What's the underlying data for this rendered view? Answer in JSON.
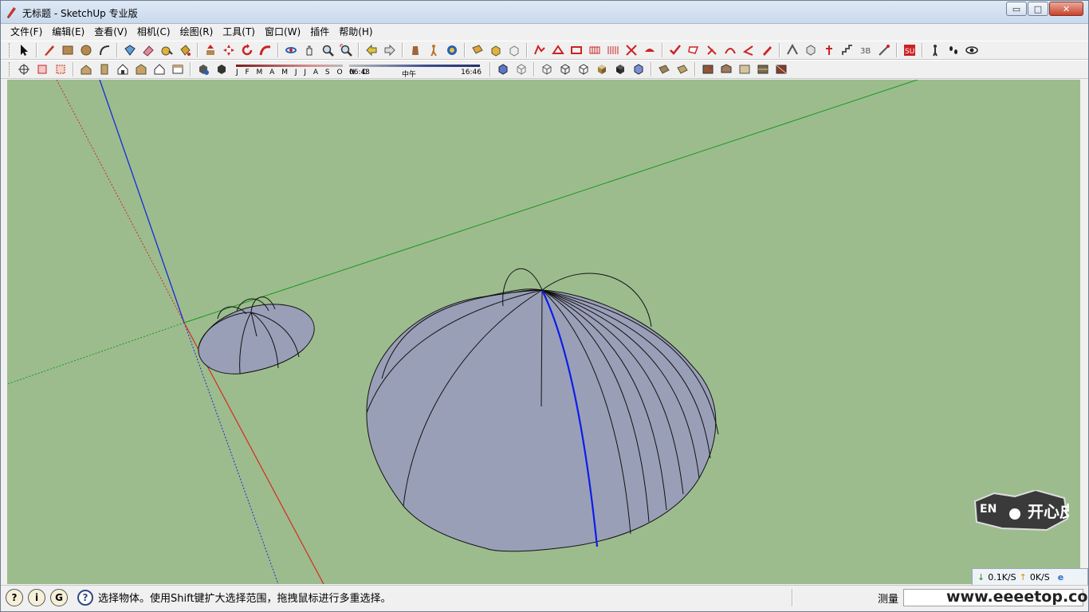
{
  "window": {
    "title": "无标题 - SketchUp 专业版",
    "controls": {
      "minimize": "▭",
      "maximize": "□",
      "close": "✕"
    }
  },
  "menu": [
    "文件(F)",
    "编辑(E)",
    "查看(V)",
    "相机(C)",
    "绘图(R)",
    "工具(T)",
    "窗口(W)",
    "插件",
    "帮助(H)"
  ],
  "shadow": {
    "months": "J F M A M J J A S O N D",
    "time_start": "06:43",
    "time_mid": "中午",
    "time_end": "16:46"
  },
  "status": {
    "message": "选择物体。使用Shift键扩大选择范围，拖拽鼠标进行多重选择。",
    "measure_label": "测量",
    "measure_value": ""
  },
  "network": {
    "down": "0.1K/S",
    "up": "0K/S"
  },
  "badge": {
    "text_en": "EN",
    "text_cn": "开心皮"
  },
  "watermark": "www.eeeetop.com",
  "colors": {
    "viewport_bg": "#9cbc8e",
    "face_fill": "#9a9fb8",
    "axis_red": "#d42b1e",
    "axis_green": "#1a9a1a",
    "axis_blue": "#1a2ad6",
    "selected_edge": "#0a1ee8"
  },
  "icons": {
    "toolbar1": [
      "select-icon",
      "pencil-icon",
      "rectangle-icon",
      "circle-icon",
      "arc-icon",
      "make-component-icon",
      "eraser-icon",
      "tape-measure-icon",
      "paint-bucket-icon",
      "push-pull-icon",
      "move-icon",
      "rotate-icon",
      "follow-me-icon",
      "orbit-icon",
      "pan-icon",
      "zoom-icon",
      "zoom-extents-icon",
      "previous-view-icon",
      "next-view-icon",
      "position-camera-icon",
      "walk-icon",
      "look-around-icon",
      "section-plane-icon",
      "solid-tools-icon",
      "intersect-icon"
    ],
    "toolbar2": [
      "axes-icon",
      "xray-icon",
      "back-edges-icon",
      "iso-view-icon",
      "top-view-icon",
      "front-view-icon",
      "right-view-icon",
      "back-view-icon",
      "left-view-icon",
      "shadow-settings-icon",
      "display-shadows-icon"
    ]
  }
}
